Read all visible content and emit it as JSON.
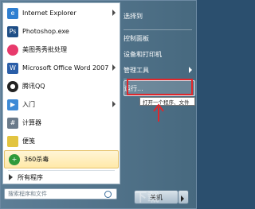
{
  "left_items": [
    {
      "label": "Internet Explorer",
      "icon": "ie-icon",
      "color": "#2f7fd1",
      "has_arrow": true
    },
    {
      "label": "Photoshop.exe",
      "icon": "photoshop-icon",
      "color": "#1e4e86",
      "has_arrow": false
    },
    {
      "label": "美图秀秀批处理",
      "icon": "meitu-icon",
      "color": "#e83a6c",
      "has_arrow": false
    },
    {
      "label": "Microsoft Office Word 2007",
      "icon": "word-icon",
      "color": "#2a5ea8",
      "has_arrow": true
    },
    {
      "label": "腾讯QQ",
      "icon": "qq-icon",
      "color": "#222222",
      "has_arrow": false
    },
    {
      "label": "入门",
      "icon": "getting-started-icon",
      "color": "#3d8ad6",
      "has_arrow": true
    },
    {
      "label": "计算器",
      "icon": "calculator-icon",
      "color": "#6a7a8a",
      "has_arrow": false
    },
    {
      "label": "便笺",
      "icon": "sticky-notes-icon",
      "color": "#e2c440",
      "has_arrow": false
    },
    {
      "label": "360杀毒",
      "icon": "360-antivirus-icon",
      "color": "#2f9a3a",
      "has_arrow": false
    }
  ],
  "all_programs": "所有程序",
  "search_placeholder": "搜索程序和文件",
  "right_items": [
    {
      "label": "选择到",
      "has_arrow": false
    },
    {
      "label": "控制面板",
      "has_arrow": false
    },
    {
      "label": "设备和打印机",
      "has_arrow": false
    },
    {
      "label": "管理工具",
      "has_arrow": true
    },
    {
      "label": "运行...",
      "has_arrow": false
    }
  ],
  "tooltip": "打开一个程序、文件",
  "shutdown_label": "关机",
  "watermark": "下载",
  "accent_red": "#e0272b"
}
